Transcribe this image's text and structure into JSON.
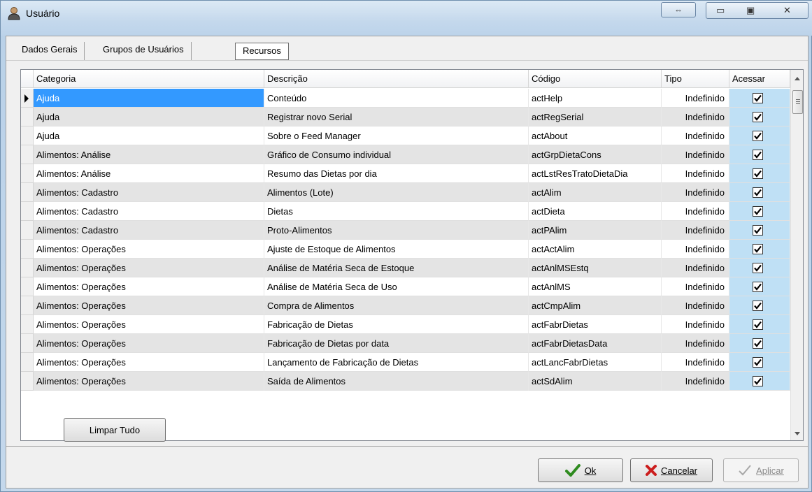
{
  "window": {
    "title": "Usuário"
  },
  "tabs": [
    "Dados Gerais",
    "Grupos de Usuários",
    "Recursos"
  ],
  "grid": {
    "columns": [
      "Categoria",
      "Descrição",
      "Código",
      "Tipo",
      "Acessar"
    ],
    "rows": [
      {
        "categoria": "Ajuda",
        "descricao": "Conteúdo",
        "codigo": "actHelp",
        "tipo": "Indefinido",
        "acessar": true
      },
      {
        "categoria": "Ajuda",
        "descricao": "Registrar novo Serial",
        "codigo": "actRegSerial",
        "tipo": "Indefinido",
        "acessar": true
      },
      {
        "categoria": "Ajuda",
        "descricao": "Sobre o Feed Manager",
        "codigo": "actAbout",
        "tipo": "Indefinido",
        "acessar": true
      },
      {
        "categoria": "Alimentos: Análise",
        "descricao": "Gráfico de Consumo individual",
        "codigo": "actGrpDietaCons",
        "tipo": "Indefinido",
        "acessar": true
      },
      {
        "categoria": "Alimentos: Análise",
        "descricao": "Resumo das Dietas por dia",
        "codigo": "actLstResTratoDietaDia",
        "tipo": "Indefinido",
        "acessar": true
      },
      {
        "categoria": "Alimentos: Cadastro",
        "descricao": "Alimentos (Lote)",
        "codigo": "actAlim",
        "tipo": "Indefinido",
        "acessar": true
      },
      {
        "categoria": "Alimentos: Cadastro",
        "descricao": "Dietas",
        "codigo": "actDieta",
        "tipo": "Indefinido",
        "acessar": true
      },
      {
        "categoria": "Alimentos: Cadastro",
        "descricao": "Proto-Alimentos",
        "codigo": "actPAlim",
        "tipo": "Indefinido",
        "acessar": true
      },
      {
        "categoria": "Alimentos: Operações",
        "descricao": "Ajuste de Estoque de Alimentos",
        "codigo": "actActAlim",
        "tipo": "Indefinido",
        "acessar": true
      },
      {
        "categoria": "Alimentos: Operações",
        "descricao": "Análise de Matéria Seca de Estoque",
        "codigo": "actAnlMSEstq",
        "tipo": "Indefinido",
        "acessar": true
      },
      {
        "categoria": "Alimentos: Operações",
        "descricao": "Análise de Matéria Seca de Uso",
        "codigo": "actAnlMS",
        "tipo": "Indefinido",
        "acessar": true
      },
      {
        "categoria": "Alimentos: Operações",
        "descricao": "Compra de Alimentos",
        "codigo": "actCmpAlim",
        "tipo": "Indefinido",
        "acessar": true
      },
      {
        "categoria": "Alimentos: Operações",
        "descricao": "Fabricação de Dietas",
        "codigo": "actFabrDietas",
        "tipo": "Indefinido",
        "acessar": true
      },
      {
        "categoria": "Alimentos: Operações",
        "descricao": "Fabricação de Dietas por data",
        "codigo": "actFabrDietasData",
        "tipo": "Indefinido",
        "acessar": true
      },
      {
        "categoria": "Alimentos: Operações",
        "descricao": "Lançamento de Fabricação de Dietas",
        "codigo": "actLancFabrDietas",
        "tipo": "Indefinido",
        "acessar": true
      },
      {
        "categoria": "Alimentos: Operações",
        "descricao": "Saída de Alimentos",
        "codigo": "actSdAlim",
        "tipo": "Indefinido",
        "acessar": true
      }
    ],
    "selected_row": 0
  },
  "buttons": {
    "clear_all": "Limpar Tudo",
    "ok": "Ok",
    "cancel": "Cancelar",
    "apply": "Aplicar"
  },
  "colors": {
    "selection": "#3399ff",
    "acessar_column": "#bfe0f5",
    "alt_row": "#e4e4e4"
  }
}
